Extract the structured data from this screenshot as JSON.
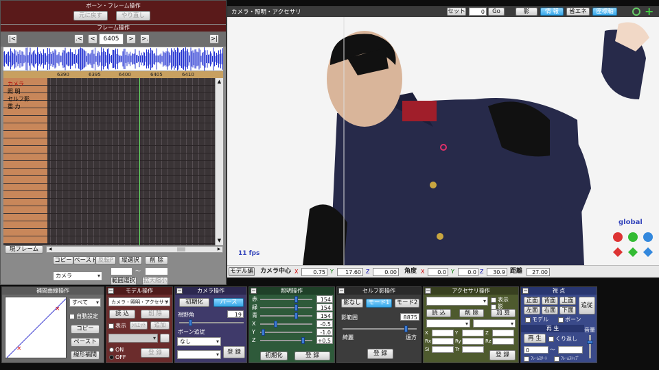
{
  "timeline": {
    "title": "ボーン・フレーム操作",
    "undo": "元に戻す",
    "redo": "やり直し",
    "frame_section": "フレーム操作",
    "nav_first": "|<",
    "nav_prev_key": ".<",
    "nav_prev": "<",
    "frame_value": "6405",
    "nav_next": ">",
    "nav_next_key": ">.",
    "nav_last": ">|",
    "ruler": [
      "6390",
      "6395",
      "6400",
      "6405",
      "6410"
    ],
    "rows": [
      "カメラ",
      "照 明",
      "セルフ影",
      "重 力"
    ],
    "current_frame_label": "現フレーム",
    "copy": "コピー",
    "paste": "ペースト",
    "reverse_paste": "反転P",
    "vertical_select": "縦選択",
    "delete": "削 除",
    "target_select": "カメラ",
    "range_select": "範囲選択",
    "expand": "拡大縮小",
    "tilde": "～"
  },
  "viewport": {
    "title": "カメラ・照明・アクセサリ",
    "set_label": "セット",
    "set_value": "0",
    "go": "Go",
    "tabs": [
      "影",
      "情 報",
      "省エネ",
      "座標軸"
    ],
    "fps": "11 fps",
    "global": "global"
  },
  "camera_bar": {
    "model_edit": "モデル編",
    "center_label": "カメラ中心",
    "x": "0.75",
    "y": "17.60",
    "z": "0.00",
    "angle_label": "角度",
    "ax": "0.0",
    "ay": "0.0",
    "az": "30.9",
    "distance_label": "距離",
    "distance": "27.00"
  },
  "interp": {
    "title": "補間曲線操作",
    "all_select": "すべて",
    "auto": "自動設定",
    "copy": "コピー",
    "paste": "ペースト",
    "linear": "線形補間"
  },
  "model": {
    "title": "モデル操作",
    "select": "カメラ・照明・アクセサリ",
    "load": "読 込",
    "delete": "削 除",
    "show": "表示",
    "shadow": "ｼﾙｴｯﾄ",
    "add": "追加",
    "on": "ON",
    "off": "OFF",
    "register": "登 録"
  },
  "camera": {
    "title": "カメラ操作",
    "init": "初期化",
    "perspective": "パース",
    "fov_label": "視野角",
    "fov": "19",
    "follow_label": "ボーン追従",
    "follow": "なし",
    "register": "登 録"
  },
  "light": {
    "title": "照明操作",
    "rows": [
      {
        "label": "赤",
        "value": "154"
      },
      {
        "label": "緑",
        "value": "154"
      },
      {
        "label": "青",
        "value": "154"
      },
      {
        "label": "X",
        "value": "-0.5"
      },
      {
        "label": "Y",
        "value": "-1.0"
      },
      {
        "label": "Z",
        "value": "+0.5"
      }
    ],
    "init": "初期化",
    "register": "登 録"
  },
  "selfshadow": {
    "title": "セルフ影操作",
    "none": "影なし",
    "mode1": "モード1",
    "mode2": "モード2",
    "range_label": "影範囲",
    "range": "8875",
    "near": "綺麗",
    "far": "遠方",
    "register": "登 録"
  },
  "accessory": {
    "title": "アクセサリ操作",
    "show": "表示",
    "shadow": "影",
    "load": "読 込",
    "delete": "削 除",
    "add": "加 算",
    "labels": [
      "X",
      "Y",
      "Z",
      "Rx",
      "Ry",
      "Rz",
      "Si",
      "Tr"
    ],
    "register": "登 録"
  },
  "view": {
    "title": "視 点",
    "front": "正面",
    "back": "背面",
    "top": "上面",
    "track": "追従",
    "left": "左面",
    "right": "右面",
    "bottom": "下面",
    "model": "モデル",
    "bone": "ボーン",
    "play_title": "再 生",
    "play": "再 生",
    "loop": "くり返し",
    "volume": "音量",
    "frame_start_label": "ﾌﾚｰﾑｽﾀｰﾄ",
    "frame_stop_label": "ﾌﾚｰﾑｽﾄｯﾌﾟ",
    "start_value": "0",
    "tilde": "～"
  },
  "colors": {
    "header_maroon": "#5a1a1a",
    "timeline_bg": "#3a3436",
    "row_brown": "#c8875a",
    "wave_blue": "#1f2fd0",
    "model_panel": "#6b2c2c",
    "camera_panel": "#3f3a6a",
    "light_panel": "#2e5a3a",
    "accessory_panel": "#4e5a2e",
    "view_panel": "#3a4a8a"
  }
}
